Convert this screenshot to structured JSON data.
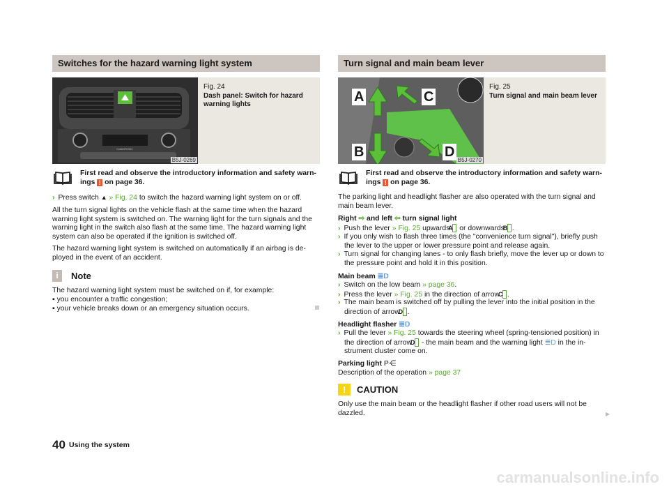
{
  "left": {
    "title": "Switches for the hazard warning light system",
    "figure": {
      "number": "Fig. 24",
      "caption": "Dash panel: Switch for hazard warning lights",
      "image_code": "B5J-0269",
      "panel_text": "CLIMATRONIC"
    },
    "intro": {
      "text_a": "First read and observe the introductory information and safety warn-ings",
      "warn_icon": "warning-exclamation",
      "text_b": "on page 36."
    },
    "step": {
      "a": "Press switch",
      "icon": "hazard-triangle",
      "link": "» Fig. 24",
      "b": "to switch the hazard warning light system on or off."
    },
    "para1": "All the turn signal lights on the vehicle flash at the same time when the hazard warning light system is switched on. The warning light for the turn signals and the warning light in the switch also flash at the same time. The hazard warning light system can also be operated if the ignition is switched off.",
    "para2": "The hazard warning light system is switched on automatically if an airbag is de-ployed in the event of an accident.",
    "note": {
      "title": "Note",
      "text": "The hazard warning light system must be switched on if, for example:",
      "items": [
        "you encounter a traffic congestion;",
        "your vehicle breaks down or an emergency situation occurs."
      ]
    }
  },
  "right": {
    "title": "Turn signal and main beam lever",
    "figure": {
      "number": "Fig. 25",
      "caption": "Turn signal and main beam lever",
      "image_code": "B5J-0270",
      "arrows": [
        "A",
        "B",
        "C",
        "D"
      ]
    },
    "intro": {
      "text_a": "First read and observe the introductory information and safety warn-ings",
      "text_b": "on page 36."
    },
    "para1": "The parking light and headlight flasher are also operated with the turn signal and main beam lever.",
    "turn": {
      "h_a": "Right",
      "h_b": "and left",
      "h_c": "turn signal light",
      "b1": {
        "a": "Push the lever",
        "link": "» Fig. 25",
        "b": "upwards",
        "k1": "A",
        "c": "or downwards",
        "k2": "B",
        "d": "."
      },
      "b2": "If you only wish to flash three times (the \"convenience turn signal\"), briefly push the lever to the upper or lower pressure point and release again.",
      "b3": "Turn signal for changing lanes - to only flash briefly, move the lever up or down to the pressure point and hold it in this position."
    },
    "main": {
      "h": "Main beam",
      "b1": {
        "a": "Switch on the low beam",
        "link": "» page 36",
        "b": "."
      },
      "b2": {
        "a": "Press the lever",
        "link": "» Fig. 25",
        "b": "in the direction of arrow",
        "k": "C",
        "c": "."
      },
      "b3": {
        "a": "The main beam is switched off by pulling the lever into the initial position in the direction of arrow",
        "k": "D",
        "b": "."
      }
    },
    "flasher": {
      "h": "Headlight flasher",
      "b1": {
        "a": "Pull the lever",
        "link": "» Fig. 25",
        "b": "towards the steering wheel (spring-tensioned position) in the direction of arrow",
        "k": "D",
        "c": "- the main beam and the warning light",
        "d": "in the in-strument cluster come on."
      }
    },
    "parking": {
      "h": "Parking light",
      "text": "Description of the operation",
      "link": "» page 37"
    },
    "caution": {
      "title": "CAUTION",
      "text": "Only use the main beam or the headlight flasher if other road users will not be dazzled."
    }
  },
  "footer": {
    "page": "40",
    "section": "Using the system"
  },
  "watermark": "carmanualsonline.info",
  "colors": {
    "link": "#5aa832",
    "header": "#cdc5bf",
    "caption_bg": "#ebe8e1",
    "warning": "#e8552f",
    "caution": "#f5d419"
  }
}
